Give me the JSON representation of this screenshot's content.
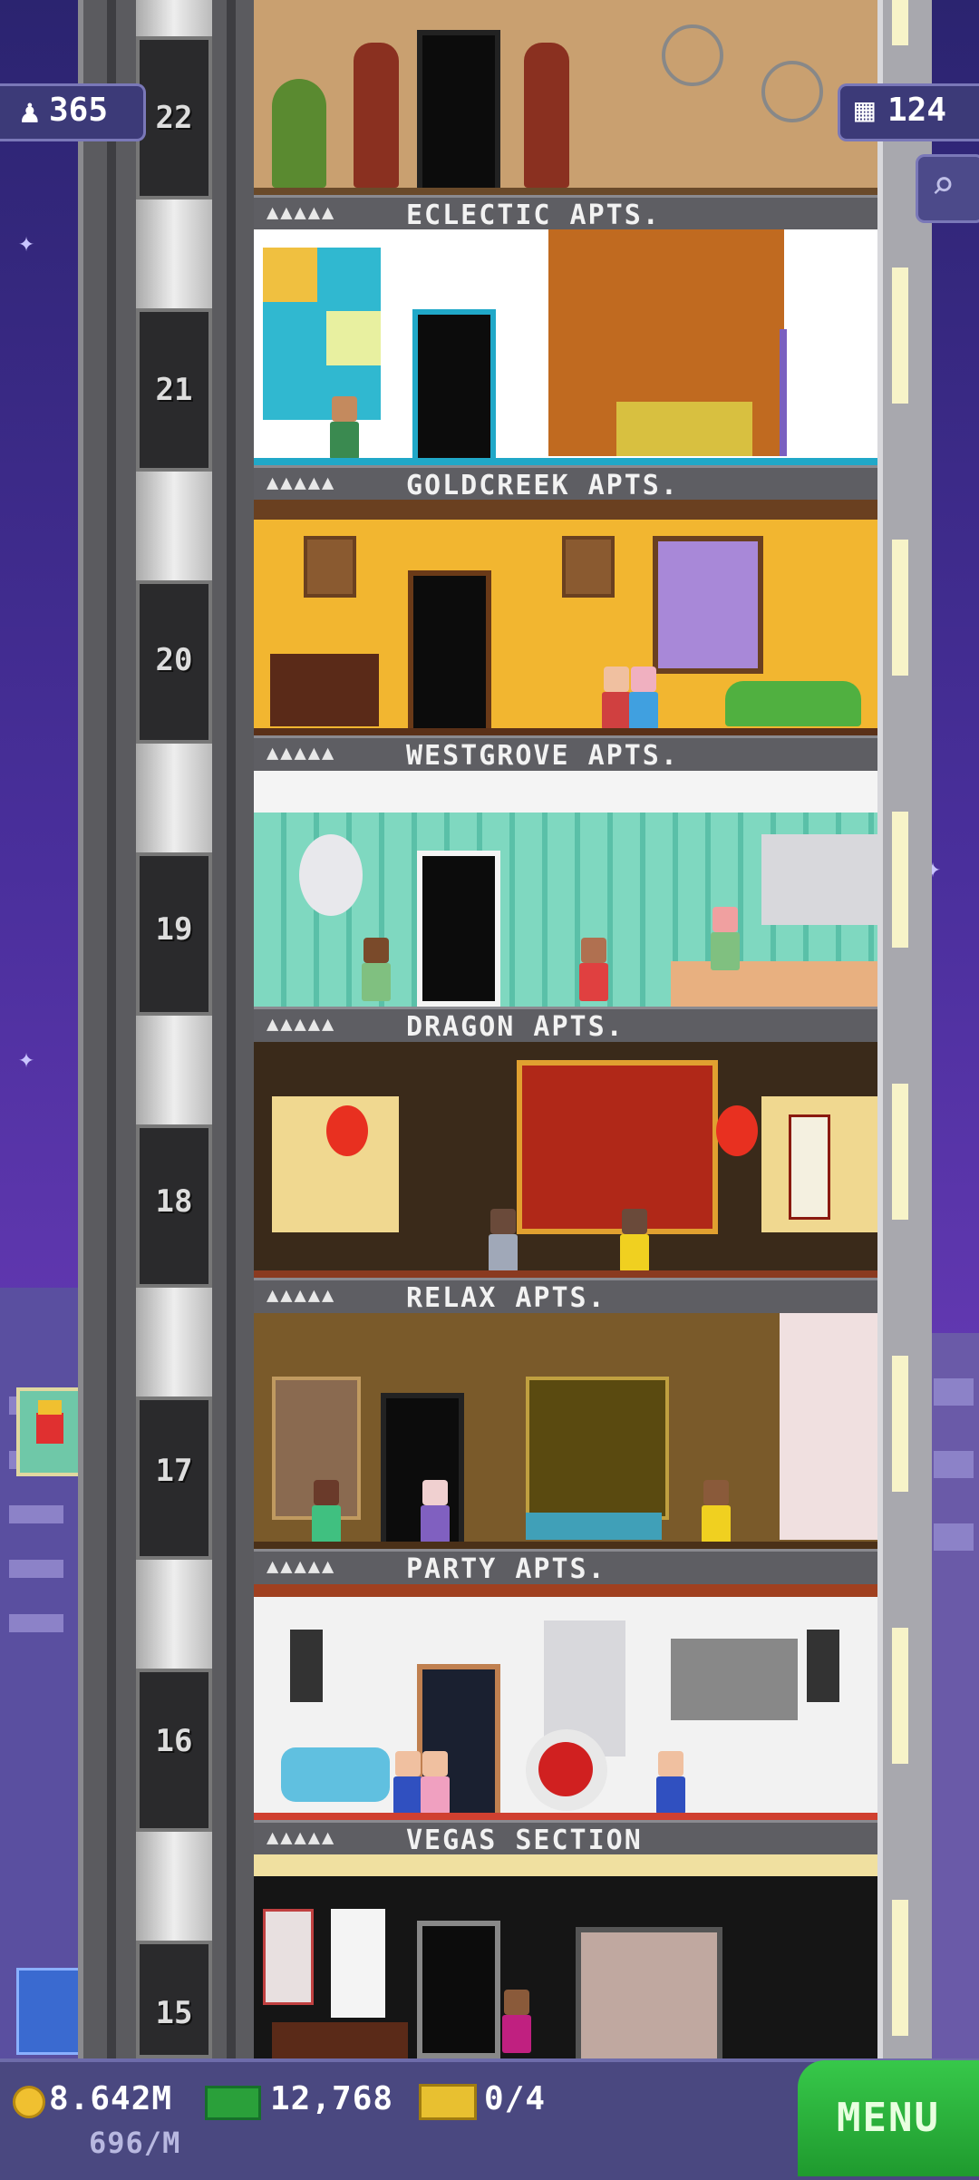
{
  "hud": {
    "population": "365",
    "floor_count": "124",
    "coins": "8.642M",
    "coins_rate": "696/M",
    "bux": "12,768",
    "tickets": "0/4",
    "menu_label": "MENU"
  },
  "floors": [
    {
      "number": "22",
      "label": "ECLECTIC APTS.",
      "residents_dots": "▲▲▲▲▲"
    },
    {
      "number": "21",
      "label": "GOLDCREEK APTS.",
      "residents_dots": "▲▲▲▲▲"
    },
    {
      "number": "20",
      "label": "WESTGROVE APTS.",
      "residents_dots": "▲▲▲▲▲"
    },
    {
      "number": "19",
      "label": "DRAGON APTS.",
      "residents_dots": "▲▲▲▲▲"
    },
    {
      "number": "18",
      "label": "RELAX APTS.",
      "residents_dots": "▲▲▲▲▲"
    },
    {
      "number": "17",
      "label": "PARTY APTS.",
      "residents_dots": "▲▲▲▲▲"
    },
    {
      "number": "16",
      "label": "VEGAS SECTION",
      "residents_dots": "▲▲▲▲▲"
    },
    {
      "number": "15",
      "label": "",
      "residents_dots": ""
    }
  ],
  "colors": {
    "eclectic": "#c9a070",
    "goldcreek": "#ffffff",
    "westgrove": "#f2b630",
    "dragon": "#7fd8c0",
    "relax": "#3a2a1a",
    "party": "#7a5a2a",
    "vegas": "#f2f2f2",
    "vegas_lower": "#151515"
  }
}
